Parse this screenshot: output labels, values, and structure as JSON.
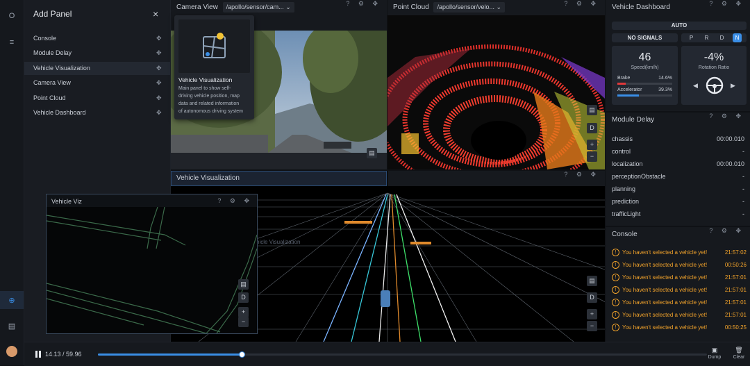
{
  "sidebar": {
    "items": [
      "O",
      "≡",
      "⊕",
      "▤"
    ]
  },
  "add_panel": {
    "title": "Add Panel",
    "close": "×",
    "items": [
      {
        "label": "Console"
      },
      {
        "label": "Module Delay"
      },
      {
        "label": "Vehicle Visualization"
      },
      {
        "label": "Camera View"
      },
      {
        "label": "Point Cloud"
      },
      {
        "label": "Vehicle Dashboard"
      }
    ],
    "move_glyph": "✥"
  },
  "tooltip": {
    "title": "Vehicle Visualization",
    "desc_lines": [
      "Main panel to show self-",
      "driving vehicle position, map",
      "data and related information",
      "of autonomous driving system"
    ]
  },
  "camera_view": {
    "title": "Camera View",
    "channel": "/apollo/sensor/cam...",
    "chevron": "⌄"
  },
  "point_cloud": {
    "title": "Point Cloud",
    "channel": "/apollo/sensor/velo...",
    "chevron": "⌄"
  },
  "vehicle_visualization": {
    "title": "Vehicle Visualization",
    "faded_label": "hicle Visualization",
    "controls": [
      "D",
      "+",
      "−"
    ]
  },
  "vehicle_viz": {
    "title": "Vehicle Viz",
    "controls": [
      "D",
      "+",
      "−"
    ]
  },
  "panel_icons": "? ⚙ ✥",
  "dashboard": {
    "title": "Vehicle Dashboard",
    "mode": "AUTO",
    "signals": "NO SIGNALS",
    "gears": [
      "P",
      "R",
      "D",
      "N"
    ],
    "active_gear": "N",
    "speed": "46",
    "speed_label": "Speed(km/h)",
    "brake_label": "Brake",
    "brake_value": "14.6%",
    "brake_fraction": 0.146,
    "accel_label": "Accelerator",
    "accel_value": "39.3%",
    "accel_fraction": 0.393,
    "rotation": "-4%",
    "rotation_label": "Rotation Ratio"
  },
  "module_delay": {
    "title": "Module Delay",
    "rows": [
      {
        "name": "chassis",
        "value": "00:00.010"
      },
      {
        "name": "control",
        "value": "-"
      },
      {
        "name": "localization",
        "value": "00:00.010"
      },
      {
        "name": "perceptionObstacle",
        "value": "-"
      },
      {
        "name": "planning",
        "value": "-"
      },
      {
        "name": "prediction",
        "value": "-"
      },
      {
        "name": "trafficLight",
        "value": "-"
      }
    ]
  },
  "console": {
    "title": "Console",
    "rows": [
      {
        "msg": "You haven't selected a vehicle yet!",
        "time": "21:57:02"
      },
      {
        "msg": "You haven't selected a vehicle yet!",
        "time": "00:50:26"
      },
      {
        "msg": "You haven't selected a vehicle yet!",
        "time": "21:57:01"
      },
      {
        "msg": "You haven't selected a vehicle yet!",
        "time": "21:57:01"
      },
      {
        "msg": "You haven't selected a vehicle yet!",
        "time": "21:57:01"
      },
      {
        "msg": "You haven't selected a vehicle yet!",
        "time": "21:57:01"
      },
      {
        "msg": "You haven't selected a vehicle yet!",
        "time": "00:50:25"
      }
    ]
  },
  "playback": {
    "time": "14.13 / 59.96",
    "progress_fraction": 0.236,
    "dump_label": "Dump",
    "clear_label": "Clear"
  }
}
